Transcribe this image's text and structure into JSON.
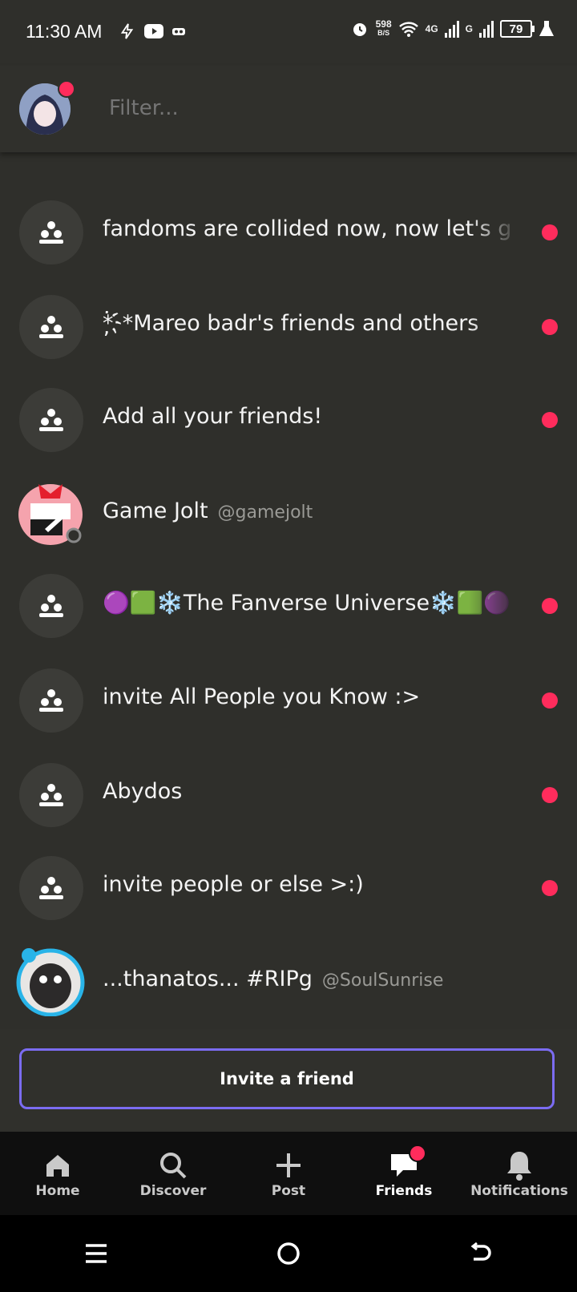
{
  "status": {
    "time": "11:30 AM",
    "speed_value": "598",
    "speed_unit": "B/S",
    "net1": "4G",
    "net2": "G",
    "battery": "79"
  },
  "header": {
    "filter_placeholder": "Filter..."
  },
  "list": [
    {
      "kind": "group",
      "title": "fandoms are collided now, now let's g",
      "unread": true
    },
    {
      "kind": "group",
      "title": "*҉*Mareo badr's friends and others",
      "unread": true
    },
    {
      "kind": "group",
      "title": "Add all your friends!",
      "unread": true
    },
    {
      "kind": "user",
      "title": "Game Jolt",
      "handle": "@gamejolt",
      "unread": false
    },
    {
      "kind": "group",
      "title": "🟣🟩❄️The Fanverse Universe❄️🟩🟣",
      "unread": true
    },
    {
      "kind": "group",
      "title": "invite All People you Know :>",
      "unread": true
    },
    {
      "kind": "group",
      "title": "Abydos",
      "unread": true
    },
    {
      "kind": "group",
      "title": "invite people or else >:)",
      "unread": true
    },
    {
      "kind": "user",
      "title": "...thanatos...  #RIPg",
      "handle": "@SoulSunrise",
      "unread": false
    }
  ],
  "invite": {
    "label": "Invite a friend"
  },
  "nav": {
    "tabs": [
      {
        "label": "Home",
        "icon": "home-icon"
      },
      {
        "label": "Discover",
        "icon": "search-icon"
      },
      {
        "label": "Post",
        "icon": "plus-icon"
      },
      {
        "label": "Friends",
        "icon": "chat-icon",
        "active": true,
        "badge": true
      },
      {
        "label": "Notifications",
        "icon": "bell-icon"
      }
    ]
  },
  "colors": {
    "background": "#2f2f2b",
    "accent": "#7b6cf2",
    "unread": "#ff2c5c",
    "nav_bg": "#0f0f0f"
  }
}
